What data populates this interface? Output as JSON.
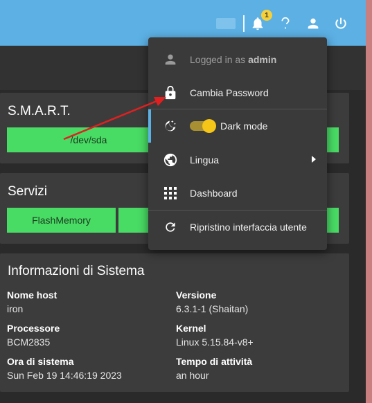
{
  "topbar": {
    "notification_count": "1",
    "icons": [
      "bell-icon",
      "help-icon",
      "user-icon",
      "power-icon"
    ]
  },
  "cards": {
    "smart": {
      "title": "S.M.A.R.T.",
      "device_button": "/dev/sda"
    },
    "services": {
      "title": "Servizi",
      "service_button": "FlashMemory"
    },
    "system_info": {
      "title": "Informazioni di Sistema",
      "fields": [
        {
          "label": "Nome host",
          "value": "iron"
        },
        {
          "label": "Versione",
          "value": "6.3.1-1 (Shaitan)"
        },
        {
          "label": "Processore",
          "value": "BCM2835"
        },
        {
          "label": "Kernel",
          "value": "Linux 5.15.84-v8+"
        },
        {
          "label": "Ora di sistema",
          "value": "Sun Feb 19 14:46:19 2023"
        },
        {
          "label": "Tempo di attività",
          "value": "an hour"
        }
      ]
    }
  },
  "user_menu": {
    "logged_in_prefix": "Logged in as",
    "username": "admin",
    "change_password": "Cambia Password",
    "dark_mode": "Dark mode",
    "dark_mode_enabled": true,
    "language": "Lingua",
    "dashboard": "Dashboard",
    "reset_ui": "Ripristino interfaccia utente"
  },
  "colors": {
    "topbar": "#5cb0e4",
    "green": "#48dc64",
    "badge": "#f5d03b",
    "annotation_arrow": "#e02020"
  }
}
